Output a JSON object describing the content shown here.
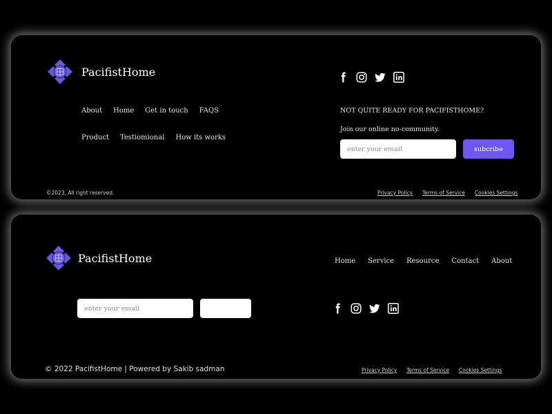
{
  "colors": {
    "background": "#000000",
    "accent": "#6f57f5",
    "logo_fill": "#6a5bd8",
    "text": "#ffffff"
  },
  "footer1": {
    "brand": "PacifistHome",
    "nav_row1": [
      "About",
      "Home",
      "Get in touch",
      "FAQS"
    ],
    "nav_row2": [
      "Product",
      "Testiomional",
      "How its works"
    ],
    "social_icons": [
      "facebook-icon",
      "instagram-icon",
      "twitter-icon",
      "linkedin-icon"
    ],
    "ready_text": "NOT QUITE READY FOR PACIFISTHOME?",
    "join_text": "Join our online no-community.",
    "email_placeholder": "enter your email",
    "subscribe_label": "subcribe",
    "copyright": "©2023, All right reserved.",
    "legal": [
      "Privacy Policy",
      "Terms of Service",
      "Cookies Settings"
    ]
  },
  "footer2": {
    "brand": "PacifistHome",
    "nav": [
      "Home",
      "Service",
      "Resource",
      "Contact",
      "About"
    ],
    "email_placeholder": "enter your email",
    "button_label": "",
    "social_icons": [
      "facebook-icon",
      "instagram-icon",
      "twitter-icon",
      "linkedin-icon"
    ],
    "copyright": "© 2022 PacifistHome | Powered by Sakib sadman",
    "legal": [
      "Privacy Policy",
      "Terms of Service",
      "Cookies Settings"
    ]
  }
}
